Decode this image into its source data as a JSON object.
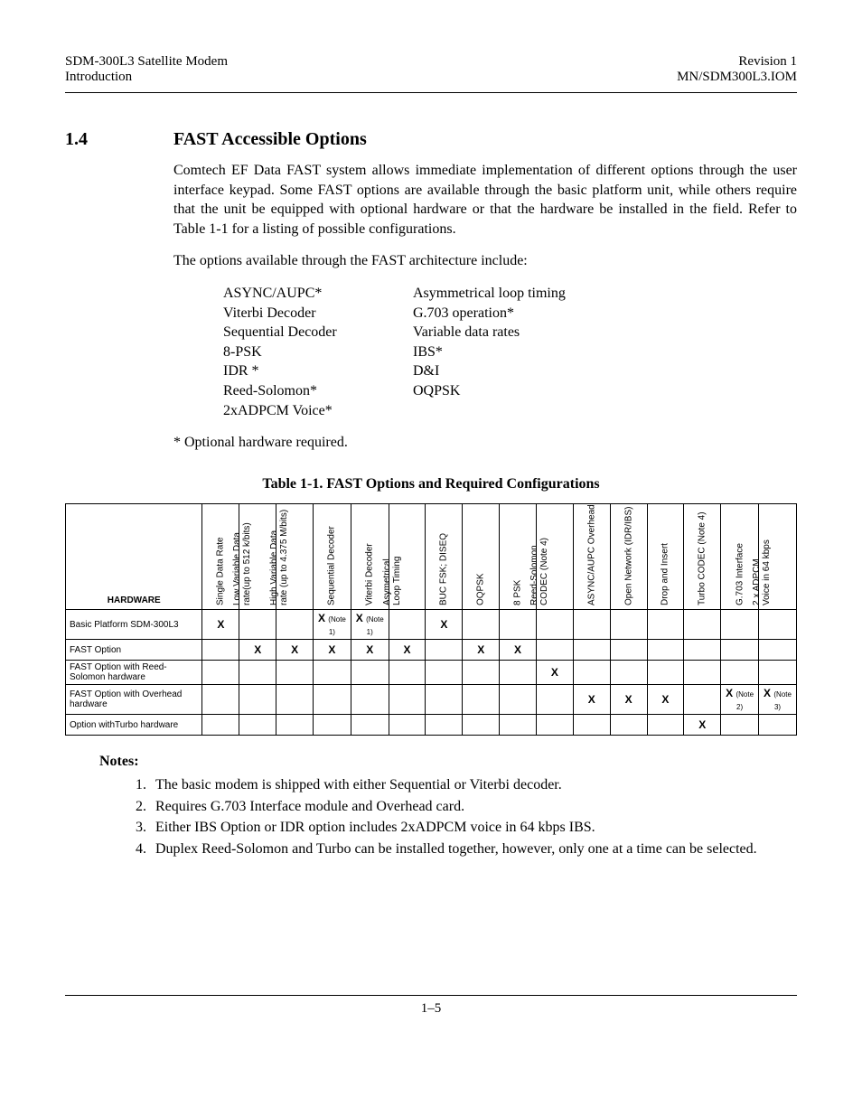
{
  "header": {
    "left1": "SDM-300L3 Satellite Modem",
    "right1": "Revision 1",
    "left2": "Introduction",
    "right2": "MN/SDM300L3.IOM"
  },
  "section": {
    "number": "1.4",
    "title": "FAST Accessible Options"
  },
  "paragraphs": {
    "p1": "Comtech EF Data FAST system allows immediate implementation of different options through the user interface keypad. Some FAST options are available through the basic platform unit, while others require that the unit be equipped with optional hardware or that the hardware be installed in the field. Refer to Table 1-1 for a listing of possible configurations.",
    "p2": "The options available through the FAST architecture include:",
    "footnote": "* Optional hardware required."
  },
  "options_list": {
    "col1": [
      "ASYNC/AUPC*",
      "Viterbi Decoder",
      "Sequential Decoder",
      "8-PSK",
      "IDR *",
      "Reed-Solomon*",
      "2xADPCM Voice*"
    ],
    "col2": [
      "Asymmetrical loop timing",
      "G.703 operation*",
      "Variable data rates",
      "IBS*",
      "D&I",
      "OQPSK"
    ]
  },
  "table": {
    "caption": "Table 1-1.  FAST Options and Required Configurations",
    "hardware_header": "HARDWARE",
    "columns": [
      "Single Data Rate",
      "Low Variable Data rate(up to 512 k/bits)",
      "High Variable Data rate (up to 4.375 M/bits)",
      "Sequential Decoder",
      "Viterbi Decoder",
      "Asymetrical Loop Timing",
      "BUC FSK; DISEQ",
      "OQPSK",
      "8 PSK",
      "Reed-Solomon CODEC (Note 4)",
      "ASYNC/AUPC Overhead",
      "Open Network (IDR/IBS)",
      "Drop and Insert",
      "Turbo CODEC (Note 4)",
      "G.703 Interface",
      "2 x ADPCM Voice in 64 kbps"
    ],
    "rows": [
      {
        "label": "Basic Platform SDM-300L3",
        "cells": [
          "X",
          "",
          "",
          "X (Note 1)",
          "X (Note 1)",
          "",
          "X",
          "",
          "",
          "",
          "",
          "",
          "",
          "",
          "",
          ""
        ]
      },
      {
        "label": "FAST Option",
        "cells": [
          "",
          "X",
          "X",
          "X",
          "X",
          "X",
          "",
          "X",
          "X",
          "",
          "",
          "",
          "",
          "",
          "",
          ""
        ]
      },
      {
        "label": "FAST Option with Reed-Solomon hardware",
        "cells": [
          "",
          "",
          "",
          "",
          "",
          "",
          "",
          "",
          "",
          "X",
          "",
          "",
          "",
          "",
          "",
          ""
        ]
      },
      {
        "label": "FAST Option with Overhead hardware",
        "cells": [
          "",
          "",
          "",
          "",
          "",
          "",
          "",
          "",
          "",
          "",
          "X",
          "X",
          "X",
          "",
          "X (Note 2)",
          "X (Note 3)"
        ]
      },
      {
        "label": "Option withTurbo hardware",
        "cells": [
          "",
          "",
          "",
          "",
          "",
          "",
          "",
          "",
          "",
          "",
          "",
          "",
          "",
          "X",
          "",
          ""
        ]
      }
    ]
  },
  "notes": {
    "title": "Notes:",
    "items": [
      "The basic modem is shipped with either Sequential or Viterbi decoder.",
      "Requires G.703 Interface module and Overhead card.",
      "Either IBS Option or IDR option includes 2xADPCM voice in 64 kbps IBS.",
      "Duplex Reed-Solomon and Turbo can be installed together, however, only one at a time can be selected."
    ]
  },
  "page_number": "1–5"
}
